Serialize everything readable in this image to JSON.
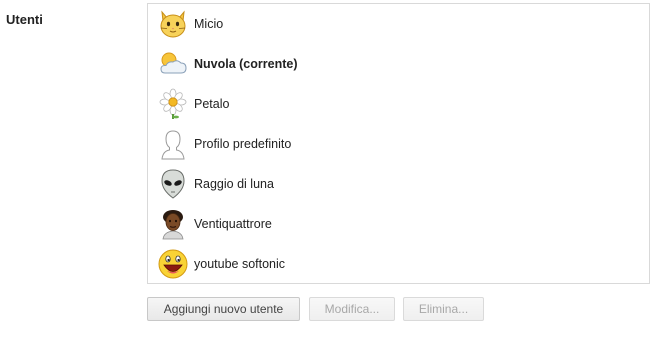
{
  "section": {
    "label": "Utenti"
  },
  "users": [
    {
      "name": "Micio",
      "avatar": "cat-icon",
      "current": false
    },
    {
      "name": "Nuvola (corrente)",
      "avatar": "sun-cloud-icon",
      "current": true
    },
    {
      "name": "Petalo",
      "avatar": "daisy-flower-icon",
      "current": false
    },
    {
      "name": "Profilo predefinito",
      "avatar": "default-silhouette-icon",
      "current": false
    },
    {
      "name": "Raggio di luna",
      "avatar": "alien-icon",
      "current": false
    },
    {
      "name": "Ventiquattrore",
      "avatar": "person-afro-icon",
      "current": false
    },
    {
      "name": "youtube softonic",
      "avatar": "smiley-face-icon",
      "current": false
    }
  ],
  "buttons": {
    "add_label": "Aggiungi nuovo utente",
    "edit_label": "Modifica...",
    "delete_label": "Elimina..."
  },
  "colors": {
    "border": "#d9d9d9",
    "text": "#222222",
    "disabled_text": "#a8a8a8"
  }
}
